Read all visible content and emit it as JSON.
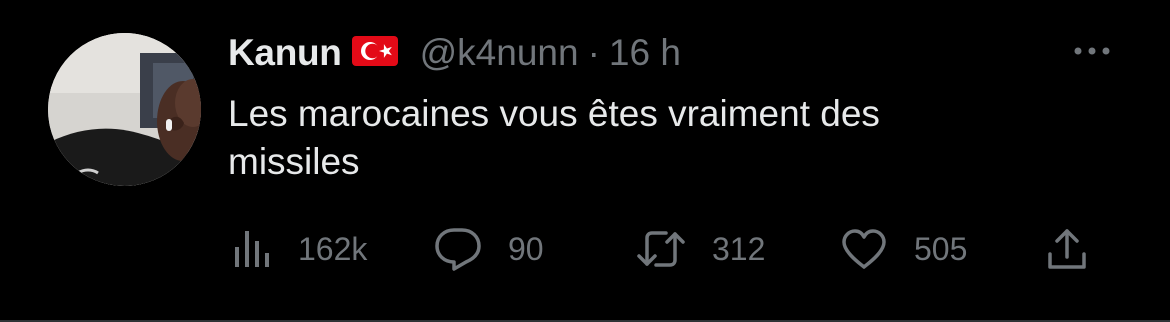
{
  "author": {
    "display_name": "Kanun",
    "handle": "@k4nunn",
    "separator": "·",
    "time": "16 h"
  },
  "tweet": {
    "text": "Les marocaines vous êtes vraiment des\nmissiles"
  },
  "actions": {
    "views": "162k",
    "replies": "90",
    "retweets": "312",
    "likes": "505"
  },
  "icons": {
    "avatar": "profile-photo",
    "flag": "turkey-flag",
    "more": "more-dots-icon",
    "views": "bar-chart-icon",
    "reply": "speech-bubble-icon",
    "retweet": "retweet-arrows-icon",
    "like": "heart-icon",
    "share": "share-upload-icon"
  },
  "colors": {
    "background": "#000000",
    "primary_text": "#e7e9ea",
    "secondary_text": "#71767b",
    "flag_red": "#e30a17"
  }
}
